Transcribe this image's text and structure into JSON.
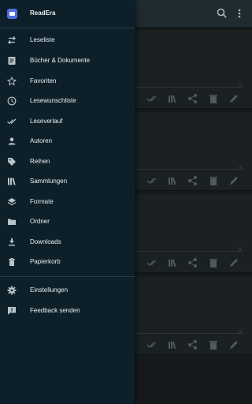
{
  "drawer": {
    "app_name": "ReadEra",
    "items": [
      {
        "label": "Leseliste",
        "icon": "swap-arrows-icon"
      },
      {
        "label": "Bücher & Dokumente",
        "icon": "document-icon"
      },
      {
        "label": "Favoriten",
        "icon": "star-icon"
      },
      {
        "label": "Lesewunschliste",
        "icon": "clock-icon"
      },
      {
        "label": "Leseverlauf",
        "icon": "double-check-icon"
      },
      {
        "label": "Autoren",
        "icon": "person-icon"
      },
      {
        "label": "Reihen",
        "icon": "tag-icon"
      },
      {
        "label": "Sammlungen",
        "icon": "books-icon"
      },
      {
        "label": "Formate",
        "icon": "layers-icon"
      },
      {
        "label": "Ordner",
        "icon": "folder-icon"
      },
      {
        "label": "Downloads",
        "icon": "download-icon"
      },
      {
        "label": "Papierkorb",
        "icon": "trash-icon"
      }
    ],
    "footer_items": [
      {
        "label": "Einstellungen",
        "icon": "gear-icon"
      },
      {
        "label": "Feedback senden",
        "icon": "feedback-icon"
      }
    ]
  },
  "appbar": {
    "icons": [
      "search-icon",
      "more-vert-icon"
    ]
  },
  "colors": {
    "drawer_bg": "#0d2029",
    "logo": "#4d6fe0",
    "icon": "#b9c4c9"
  }
}
